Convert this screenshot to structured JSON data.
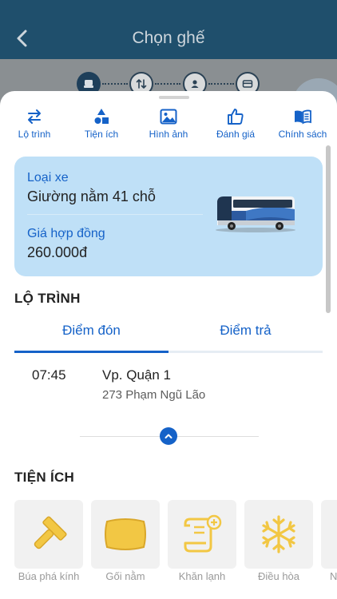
{
  "header": {
    "title": "Chọn ghế"
  },
  "tabs": [
    {
      "label": "Lộ trình",
      "icon": "swap-arrows-icon"
    },
    {
      "label": "Tiện ích",
      "icon": "shapes-icon"
    },
    {
      "label": "Hình ảnh",
      "icon": "image-icon"
    },
    {
      "label": "Đánh giá",
      "icon": "thumbs-up-icon"
    },
    {
      "label": "Chính sách",
      "icon": "book-icon"
    }
  ],
  "vehicle": {
    "type_label": "Loại xe",
    "type_value": "Giường nằm 41 chỗ",
    "price_label": "Giá hợp đồng",
    "price_value": "260.000đ"
  },
  "route": {
    "section_title": "LỘ TRÌNH",
    "tabs": [
      "Điểm đón",
      "Điểm trả"
    ],
    "selected_tab": 0,
    "stop": {
      "time": "07:45",
      "name": "Vp. Quận 1",
      "address": "273 Phạm Ngũ Lão"
    }
  },
  "amenities": {
    "section_title": "TIỆN ÍCH",
    "items": [
      {
        "label": "Búa phá kính",
        "icon": "hammer-icon"
      },
      {
        "label": "Gối nằm",
        "icon": "pillow-icon"
      },
      {
        "label": "Khăn lạnh",
        "icon": "towel-icon"
      },
      {
        "label": "Điều hòa",
        "icon": "snowflake-icon"
      },
      {
        "label": "N",
        "icon": "amenity-icon"
      }
    ]
  },
  "colors": {
    "accent": "#1562c8",
    "card": "#bfe0f7",
    "amenity_icon": "#f2c744"
  }
}
